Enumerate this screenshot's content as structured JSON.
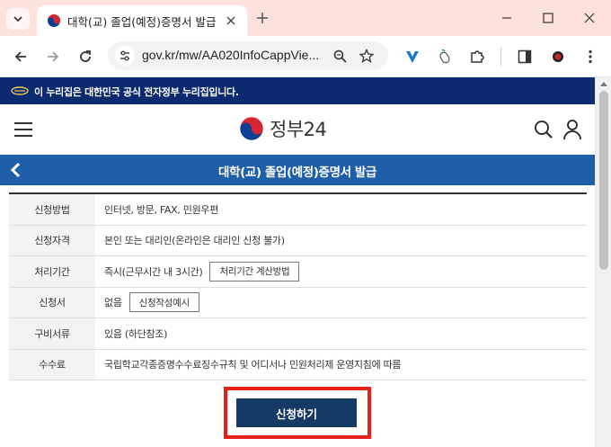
{
  "browser": {
    "tab_title": "대학(교) 졸업(예정)증명서 발급",
    "url": "gov.kr/mw/AA020InfoCappVie...",
    "icons": {
      "tab_menu": "chevron-down-icon",
      "close": "close-icon",
      "new_tab": "plus-icon",
      "minimize": "minimize-icon",
      "maximize": "maximize-icon",
      "window_close": "close-icon",
      "back": "arrow-left-icon",
      "forward": "arrow-right-icon",
      "reload": "reload-icon",
      "site_info": "tune-icon",
      "zoom": "zoom-icon",
      "bookmark": "star-icon",
      "extensions": "puzzle-icon",
      "side_panel": "side-panel-icon",
      "menu": "more-vertical-icon"
    }
  },
  "gov_notice": "이 누리집은 대한민국 공식 전자정부 누리집입니다.",
  "header": {
    "logo_text": "정부24"
  },
  "page": {
    "title": "대학(교) 졸업(예정)증명서 발급"
  },
  "rows": [
    {
      "label": "신청방법",
      "value": "인터넷, 방문, FAX, 민원우편"
    },
    {
      "label": "신청자격",
      "value": "본인 또는 대리인(온라인은 대리인 신청 불가)"
    },
    {
      "label": "처리기간",
      "value": "즉시(근무시간 내 3시간)",
      "button": "처리기간 계산방법"
    },
    {
      "label": "신청서",
      "value": "없음",
      "button": "신청작성예시"
    },
    {
      "label": "구비서류",
      "value": "있음 (하단참조)"
    },
    {
      "label": "수수료",
      "value": "국립학교각종증명수수료징수규칙 및 어디서나 민원처리제 운영지침에 따름"
    }
  ],
  "apply_button": "신청하기",
  "colors": {
    "gov_bar": "#0b2a6f",
    "title_bar": "#1f5ea8",
    "apply_button": "#163a66",
    "highlight": "#e8201a",
    "tab_strip": "#fde1dd"
  }
}
